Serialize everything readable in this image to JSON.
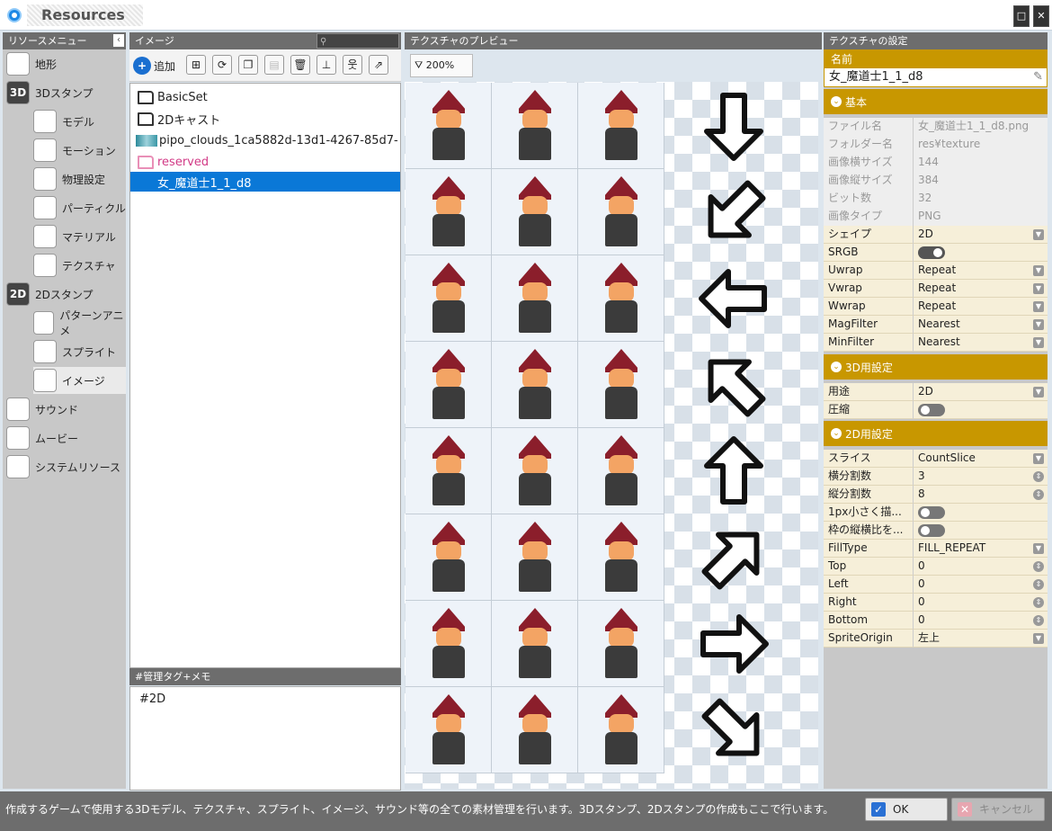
{
  "window": {
    "title": "Resources"
  },
  "left": {
    "header": "リソースメニュー",
    "items": [
      {
        "label": "地形",
        "icon": "terrain-icon"
      },
      {
        "label": "3Dスタンプ",
        "icon": "3d-stamp-icon",
        "badge": "3D"
      },
      {
        "label": "モデル",
        "icon": "model-icon"
      },
      {
        "label": "モーション",
        "icon": "motion-icon"
      },
      {
        "label": "物理設定",
        "icon": "physics-icon"
      },
      {
        "label": "パーティクル",
        "icon": "particle-icon"
      },
      {
        "label": "マテリアル",
        "icon": "material-icon"
      },
      {
        "label": "テクスチャ",
        "icon": "texture-icon"
      },
      {
        "label": "2Dスタンプ",
        "icon": "2d-stamp-icon",
        "badge": "2D"
      },
      {
        "label": "パターンアニメ",
        "icon": "pattern-anime-icon"
      },
      {
        "label": "スプライト",
        "icon": "sprite-icon"
      },
      {
        "label": "イメージ",
        "icon": "image-icon"
      },
      {
        "label": "サウンド",
        "icon": "sound-icon"
      },
      {
        "label": "ムービー",
        "icon": "movie-icon"
      },
      {
        "label": "システムリソース",
        "icon": "system-resource-icon"
      }
    ]
  },
  "images": {
    "header": "イメージ",
    "add_label": "追加",
    "zoom": "200%",
    "tree": [
      "BasicSet",
      "2Dキャスト",
      "pipo_clouds_1ca5882d-13d1-4267-85d7-",
      "reserved",
      "女_魔道士1_1_d8"
    ],
    "memo_header": "#管理タグ+メモ",
    "memo": "#2D"
  },
  "preview": {
    "header": "テクスチャのプレビュー"
  },
  "settings": {
    "header": "テクスチャの設定",
    "name_label": "名前",
    "name_value": "女_魔道士1_1_d8",
    "sec_basic": "基本",
    "sec_3d": "3D用設定",
    "sec_2d": "2D用設定",
    "basic": [
      [
        "ファイル名",
        "女_魔道士1_1_d8.png"
      ],
      [
        "フォルダー名",
        "res¥texture"
      ],
      [
        "画像横サイズ",
        "144"
      ],
      [
        "画像縦サイズ",
        "384"
      ],
      [
        "ビット数",
        "32"
      ],
      [
        "画像タイプ",
        "PNG"
      ]
    ],
    "edit": [
      [
        "シェイプ",
        "2D"
      ],
      [
        "SRGB",
        ""
      ],
      [
        "Uwrap",
        "Repeat"
      ],
      [
        "Vwrap",
        "Repeat"
      ],
      [
        "Wwrap",
        "Repeat"
      ],
      [
        "MagFilter",
        "Nearest"
      ],
      [
        "MinFilter",
        "Nearest"
      ]
    ],
    "s3d": [
      [
        "用途",
        "2D"
      ],
      [
        "圧縮",
        ""
      ]
    ],
    "s2d": [
      [
        "スライス",
        "CountSlice"
      ],
      [
        "横分割数",
        "3"
      ],
      [
        "縦分割数",
        "8"
      ],
      [
        "1px小さく描...",
        ""
      ],
      [
        "枠の縦横比を...",
        ""
      ],
      [
        "FillType",
        "FILL_REPEAT"
      ],
      [
        "Top",
        "0"
      ],
      [
        "Left",
        "0"
      ],
      [
        "Right",
        "0"
      ],
      [
        "Bottom",
        "0"
      ],
      [
        "SpriteOrigin",
        "左上"
      ]
    ]
  },
  "footer": {
    "text": "作成するゲームで使用する3Dモデル、テクスチャ、スプライト、イメージ、サウンド等の全ての素材管理を行います。3Dスタンプ、2Dスタンプの作成もここで行います。",
    "ok": "OK",
    "cancel": "キャンセル"
  }
}
